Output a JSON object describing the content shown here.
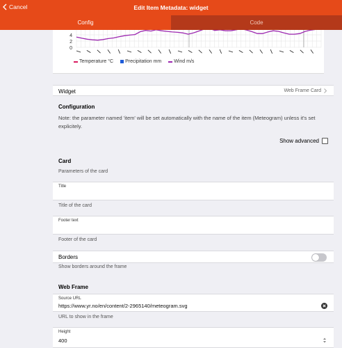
{
  "navbar": {
    "back_label": "Cancel",
    "title": "Edit Item Metadata: widget"
  },
  "tabs": [
    {
      "label": "Config"
    },
    {
      "label": "Code"
    }
  ],
  "chart_data": {
    "type": "line",
    "y_tick_labels": [
      "4",
      "2",
      "0"
    ],
    "series": [
      {
        "name": "Temperature °C",
        "color": "#d81b60"
      },
      {
        "name": "Precipitation mm",
        "color": "#1e5bd8"
      },
      {
        "name": "Wind m/s",
        "color": "#9c27b0",
        "values": [
          3.3,
          2.9,
          2.6,
          2.4,
          2.3,
          2.5,
          2.8,
          3.0,
          3.4,
          3.7,
          3.9,
          4.1,
          5.0,
          5.4,
          5.2,
          5.6,
          5.3,
          5.1,
          4.9,
          4.8,
          4.6,
          4.2,
          4.6,
          5.2,
          5.8,
          6.0,
          5.4,
          5.6,
          5.3,
          5.3,
          5.6,
          5.9,
          5.5,
          5.0,
          4.4,
          4.4,
          4.9,
          5.3,
          5.1,
          4.6,
          4.2,
          4.2,
          4.4,
          5.1,
          5.5,
          5.7,
          6.0
        ]
      }
    ],
    "legend_position": "bottom",
    "grid": true
  },
  "widget_row": {
    "label": "Widget",
    "value": "Web Frame Card"
  },
  "configuration": {
    "title": "Configuration",
    "note": "Note: the parameter named 'item' will be set automatically with the name of the item (Meteogram) unless it's set explicitely.",
    "show_advanced_label": "Show advanced"
  },
  "card": {
    "title": "Card",
    "description": "Parameters of the card",
    "title_field_label": "Title",
    "title_field_help": "Title of the card",
    "footer_field_label": "Footer text",
    "footer_field_help": "Footer of the card",
    "borders_label": "Borders",
    "borders_help": "Show borders around the frame"
  },
  "web_frame": {
    "title": "Web Frame",
    "source_label": "Source URL",
    "source_value": "https://www.yr.no/en/content/2-2965140/meteogram.svg",
    "source_help": "URL to show in the frame",
    "height_label": "Height",
    "height_value": "400"
  }
}
